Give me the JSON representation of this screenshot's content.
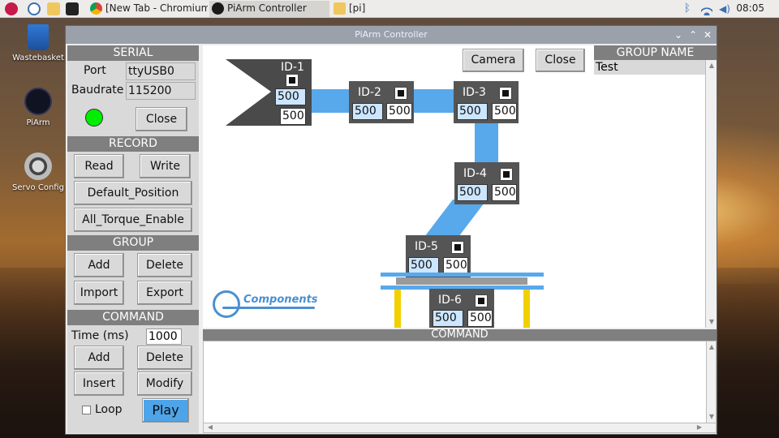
{
  "taskbar": {
    "tasks": [
      {
        "label": "[New Tab - Chromium]"
      },
      {
        "label": "PiArm Controller"
      },
      {
        "label": "[pi]"
      }
    ],
    "clock": "08:05"
  },
  "desktop": {
    "icons": [
      {
        "label": "Wastebasket"
      },
      {
        "label": "PiArm"
      },
      {
        "label": "Servo Config"
      }
    ]
  },
  "window": {
    "title": "PiArm Controller",
    "serial": {
      "header": "SERIAL",
      "port_label": "Port",
      "port_value": "ttyUSB0",
      "baud_label": "Baudrate",
      "baud_value": "115200",
      "close_label": "Close",
      "status_color": "#00ee00"
    },
    "record": {
      "header": "RECORD",
      "read": "Read",
      "write": "Write",
      "default_position": "Default_Position",
      "all_torque": "All_Torque_Enable"
    },
    "group": {
      "header": "GROUP",
      "add": "Add",
      "delete": "Delete",
      "import": "Import",
      "export": "Export"
    },
    "command": {
      "header": "COMMAND",
      "time_label": "Time (ms)",
      "time_value": "1000",
      "add": "Add",
      "delete": "Delete",
      "insert": "Insert",
      "modify": "Modify",
      "loop": "Loop",
      "play": "Play"
    },
    "canvas": {
      "camera": "Camera",
      "close": "Close",
      "logo_text": "Components",
      "servos": [
        {
          "id": "ID-1",
          "value_a": "500",
          "value_b": "500"
        },
        {
          "id": "ID-2",
          "value_a": "500",
          "value_b": "500"
        },
        {
          "id": "ID-3",
          "value_a": "500",
          "value_b": "500"
        },
        {
          "id": "ID-4",
          "value_a": "500",
          "value_b": "500"
        },
        {
          "id": "ID-5",
          "value_a": "500",
          "value_b": "500"
        },
        {
          "id": "ID-6",
          "value_a": "500",
          "value_b": "500"
        }
      ],
      "link_color": "#57a9ec"
    },
    "group_panel": {
      "header": "GROUP NAME",
      "items": [
        "Test"
      ]
    },
    "command_panel": {
      "header": "COMMAND"
    }
  }
}
